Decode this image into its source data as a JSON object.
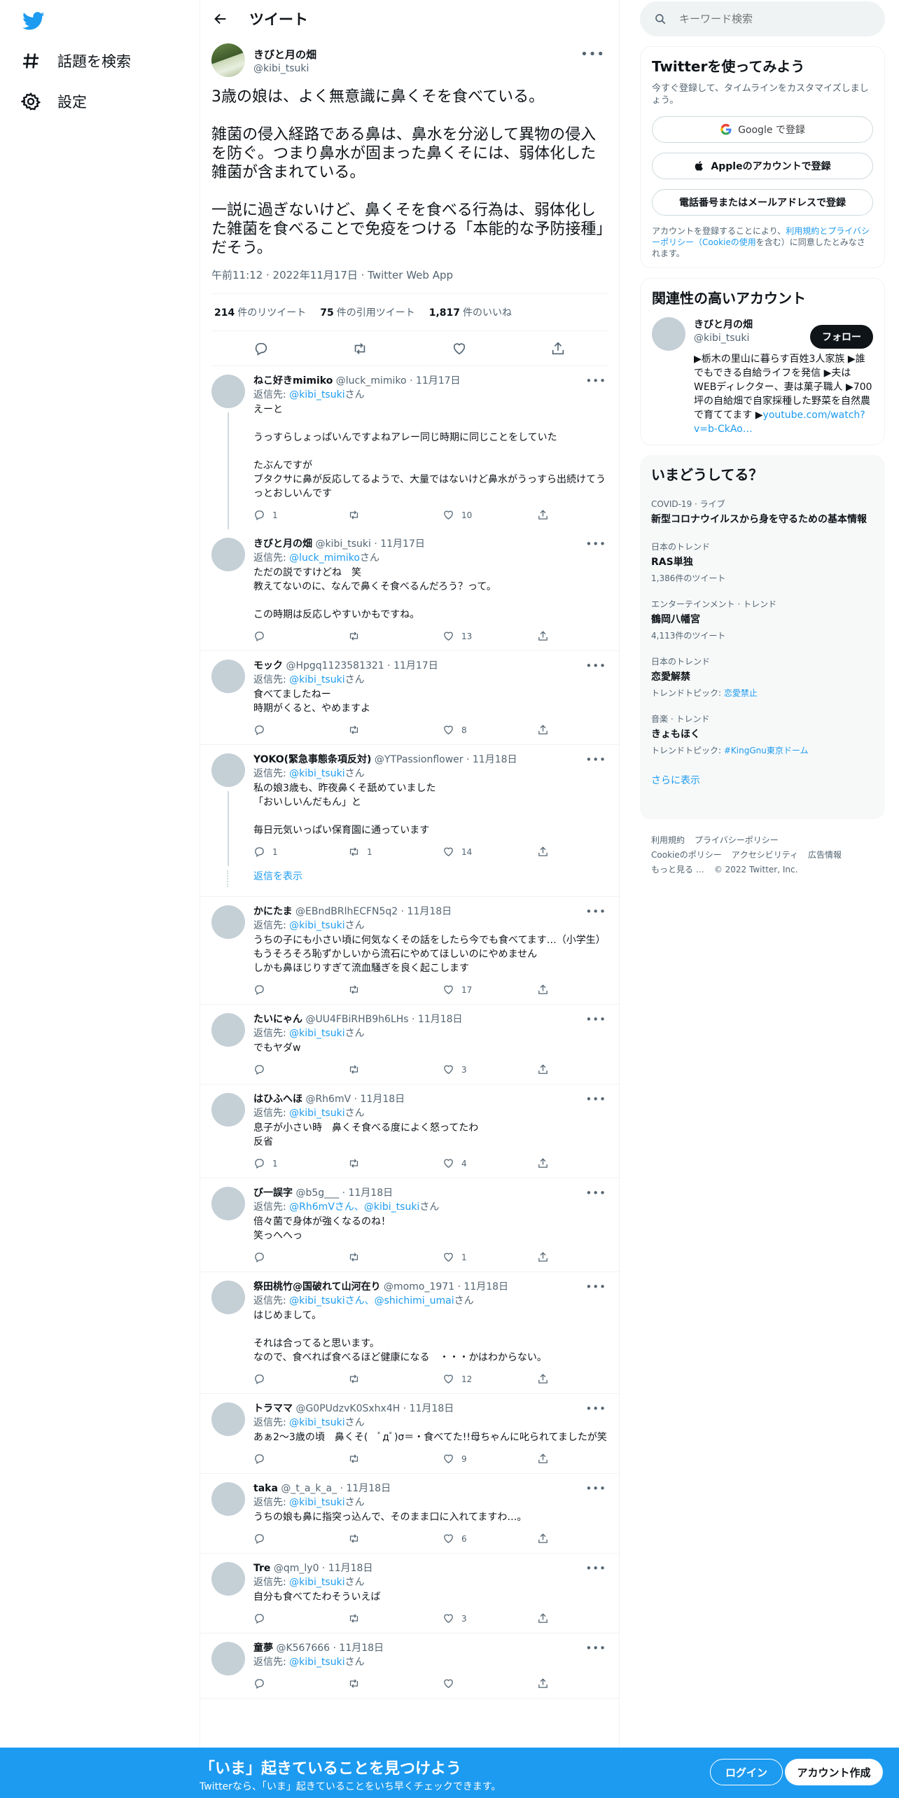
{
  "nav": {
    "explore_label": "話題を検索",
    "settings_label": "設定"
  },
  "header": {
    "title": "ツイート"
  },
  "main_tweet": {
    "name": "きびと月の畑",
    "handle": "@kibi_tsuki",
    "text": "3歳の娘は、よく無意識に鼻くそを食べている。\n\n雑菌の侵入経路である鼻は、鼻水を分泌して異物の侵入を防ぐ。つまり鼻水が固まった鼻くそには、弱体化した雑菌が含まれている。\n\n一説に過ぎないけど、鼻くそを食べる行為は、弱体化した雑菌を食べることで免疫をつける「本能的な予防接種」だそう。",
    "meta": "午前11:12 · 2022年11月17日 · Twitter Web App",
    "retweets_count": "214",
    "retweets_label": "件のリツイート",
    "quotes_count": "75",
    "quotes_label": "件の引用ツイート",
    "likes_count": "1,817",
    "likes_label": "件のいいね"
  },
  "replies": [
    {
      "name": "ねこ好きmimiko",
      "handle": "@luck_mimiko · 11月17日",
      "to_prefix": "返信先: ",
      "to": "@kibi_tsuki",
      "to_suffix": "さん",
      "text": "えーと\n\nうっすらしょっぱいんですよねアレー同じ時期に同じことをしていた\n\nたぶんですが\nブタクサに鼻が反応してるようで、大量ではないけど鼻水がうっすら出続けてうっとおしいんです",
      "replies": "1",
      "retweets": "",
      "likes": "10"
    },
    {
      "name": "きびと月の畑",
      "handle": "@kibi_tsuki · 11月17日",
      "to_prefix": "返信先: ",
      "to": "@luck_mimiko",
      "to_suffix": "さん",
      "text": "ただの説ですけどね　笑\n教えてないのに、なんで鼻くそ食べるんだろう？って。\n\nこの時期は反応しやすいかもですね。",
      "replies": "",
      "retweets": "",
      "likes": "13"
    },
    {
      "name": "モック",
      "handle": "@Hpgq1123581321 · 11月17日",
      "to_prefix": "返信先: ",
      "to": "@kibi_tsuki",
      "to_suffix": "さん",
      "text": "食べてましたねー\n時期がくると、やめますよ",
      "replies": "",
      "retweets": "",
      "likes": "8"
    },
    {
      "name": "YOKO(緊急事態条項反対)",
      "handle": "@YTPassionflower · 11月18日",
      "to_prefix": "返信先: ",
      "to": "@kibi_tsuki",
      "to_suffix": "さん",
      "text": "私の娘3歳も、昨夜鼻くそ舐めていました\n「おいしいんだもん」と\n\n毎日元気いっぱい保育園に通っています",
      "replies": "1",
      "retweets": "1",
      "likes": "14"
    },
    {
      "name": "かにたま",
      "handle": "@EBndBRlhECFN5q2 · 11月18日",
      "to_prefix": "返信先: ",
      "to": "@kibi_tsuki",
      "to_suffix": "さん",
      "text": "うちの子にも小さい頃に何気なくその話をしたら今でも食べてます…（小学生）もうそろそろ恥ずかしいから流石にやめてほしいのにやめません\nしかも鼻ほじりすぎて流血騒ぎを良く起こします",
      "replies": "",
      "retweets": "",
      "likes": "17"
    },
    {
      "name": "たいにゃん",
      "handle": "@UU4FBiRHB9h6LHs · 11月18日",
      "to_prefix": "返信先: ",
      "to": "@kibi_tsuki",
      "to_suffix": "さん",
      "text": "でもヤダw",
      "replies": "",
      "retweets": "",
      "likes": "3"
    },
    {
      "name": "はひふへほ",
      "handle": "@Rh6mV · 11月18日",
      "to_prefix": "返信先: ",
      "to": "@kibi_tsuki",
      "to_suffix": "さん",
      "text": "息子が小さい時　鼻くそ食べる度によく怒ってたわ\n反省",
      "replies": "1",
      "retweets": "",
      "likes": "4"
    },
    {
      "name": "び一誤字",
      "handle": "@b5g___ · 11月18日",
      "to_prefix": "返信先: ",
      "to": "@Rh6mVさん、@kibi_tsuki",
      "to_suffix": "さん",
      "text": "倍々菌で身体が強くなるのね！\n笑っへへっ",
      "replies": "",
      "retweets": "",
      "likes": "1"
    },
    {
      "name": "祭田桃竹@国破れて山河在り",
      "handle": "@momo_1971 · 11月18日",
      "to_prefix": "返信先: ",
      "to": "@kibi_tsukiさん、@shichimi_umai",
      "to_suffix": "さん",
      "text": "はじめまして。\n\nそれは合ってると思います。\nなので、食べれば食べるほど健康になる　・・・かはわからない。",
      "replies": "",
      "retweets": "",
      "likes": "12"
    },
    {
      "name": "トラママ",
      "handle": "@G0PUdzvK0Sxhx4H · 11月18日",
      "to_prefix": "返信先: ",
      "to": "@kibi_tsuki",
      "to_suffix": "さん",
      "text": "あぁ2〜3歳の頃　鼻くそ(　ﾟдﾟ)σ＝・食べてた!!母ちゃんに叱られてましたが笑",
      "replies": "",
      "retweets": "",
      "likes": "9"
    },
    {
      "name": "taka",
      "handle": "@_t_a_k_a_ · 11月18日",
      "to_prefix": "返信先: ",
      "to": "@kibi_tsuki",
      "to_suffix": "さん",
      "text": "うちの娘も鼻に指突っ込んで、そのまま口に入れてますわ…。",
      "replies": "",
      "retweets": "",
      "likes": "6"
    },
    {
      "name": "Tre",
      "handle": "@qm_ly0 · 11月18日",
      "to_prefix": "返信先: ",
      "to": "@kibi_tsuki",
      "to_suffix": "さん",
      "text": "自分も食べてたわそういえば",
      "replies": "",
      "retweets": "",
      "likes": "3"
    },
    {
      "name": "童夢",
      "handle": "@K567666 · 11月18日",
      "to_prefix": "返信先: ",
      "to": "@kibi_tsuki",
      "to_suffix": "さん",
      "text": "",
      "replies": "",
      "retweets": "",
      "likes": ""
    }
  ],
  "show_replies_label": "返信を表示",
  "search": {
    "placeholder": "キーワード検索"
  },
  "signup_card": {
    "title": "Twitterを使ってみよう",
    "sub": "今すぐ登録して、タイムラインをカスタマイズしましょう。",
    "google_btn": "Google で登録",
    "apple_btn": "Appleのアカウントで登録",
    "phone_btn": "電話番号またはメールアドレスで登録",
    "fine_prefix": "アカウントを登録することにより、",
    "fine_links": "利用規約とプライバシーポリシー（Cookieの使用",
    "fine_suffix": "を含む）に同意したとみなされます。"
  },
  "related": {
    "title": "関連性の高いアカウント",
    "name": "きびと月の畑",
    "handle": "@kibi_tsuki",
    "follow_label": "フォロー",
    "bio": "▶栃木の里山に暮らす百姓3人家族 ▶誰でもできる自給ライフを発信 ▶夫はWEBディレクター、妻は菓子職人 ▶700坪の自給畑で自家採種した野菜を自然農で育ててます ▶",
    "bio_link": "youtube.com/watch?v=b-CkAo…"
  },
  "trends": {
    "title": "いまどうしてる？",
    "items": [
      {
        "category": "COVID-19 · ライブ",
        "title": "新型コロナウイルスから身を守るための基本情報",
        "count": ""
      },
      {
        "category": "日本のトレンド",
        "title": "RAS単独",
        "count": "1,386件のツイート"
      },
      {
        "category": "エンターテインメント · トレンド",
        "title": "鶴岡八幡宮",
        "count": "4,113件のツイート"
      },
      {
        "category": "日本のトレンド",
        "title": "恋愛解禁",
        "count_prefix": "トレンドトピック: ",
        "count_link": "恋愛禁止"
      },
      {
        "category": "音楽 · トレンド",
        "title": "きょもほく",
        "count_prefix": "トレンドトピック: ",
        "count_link": "#KingGnu東京ドーム"
      }
    ],
    "show_more": "さらに表示"
  },
  "footer": {
    "line1a": "利用規約",
    "line1b": "プライバシーポリシー",
    "line2a": "Cookieのポリシー",
    "line2b": "アクセシビリティ",
    "line2c": "広告情報",
    "line3a": "もっと見る …",
    "line3b": "© 2022 Twitter, Inc."
  },
  "bottombar": {
    "title": "「いま」起きていることを見つけよう",
    "sub": "Twitterなら、「いま」起きていることをいち早くチェックできます。",
    "login": "ログイン",
    "signup": "アカウント作成"
  },
  "colors": {
    "accent": "#1d9bf0",
    "text": "#0f1419",
    "muted": "#536471"
  }
}
